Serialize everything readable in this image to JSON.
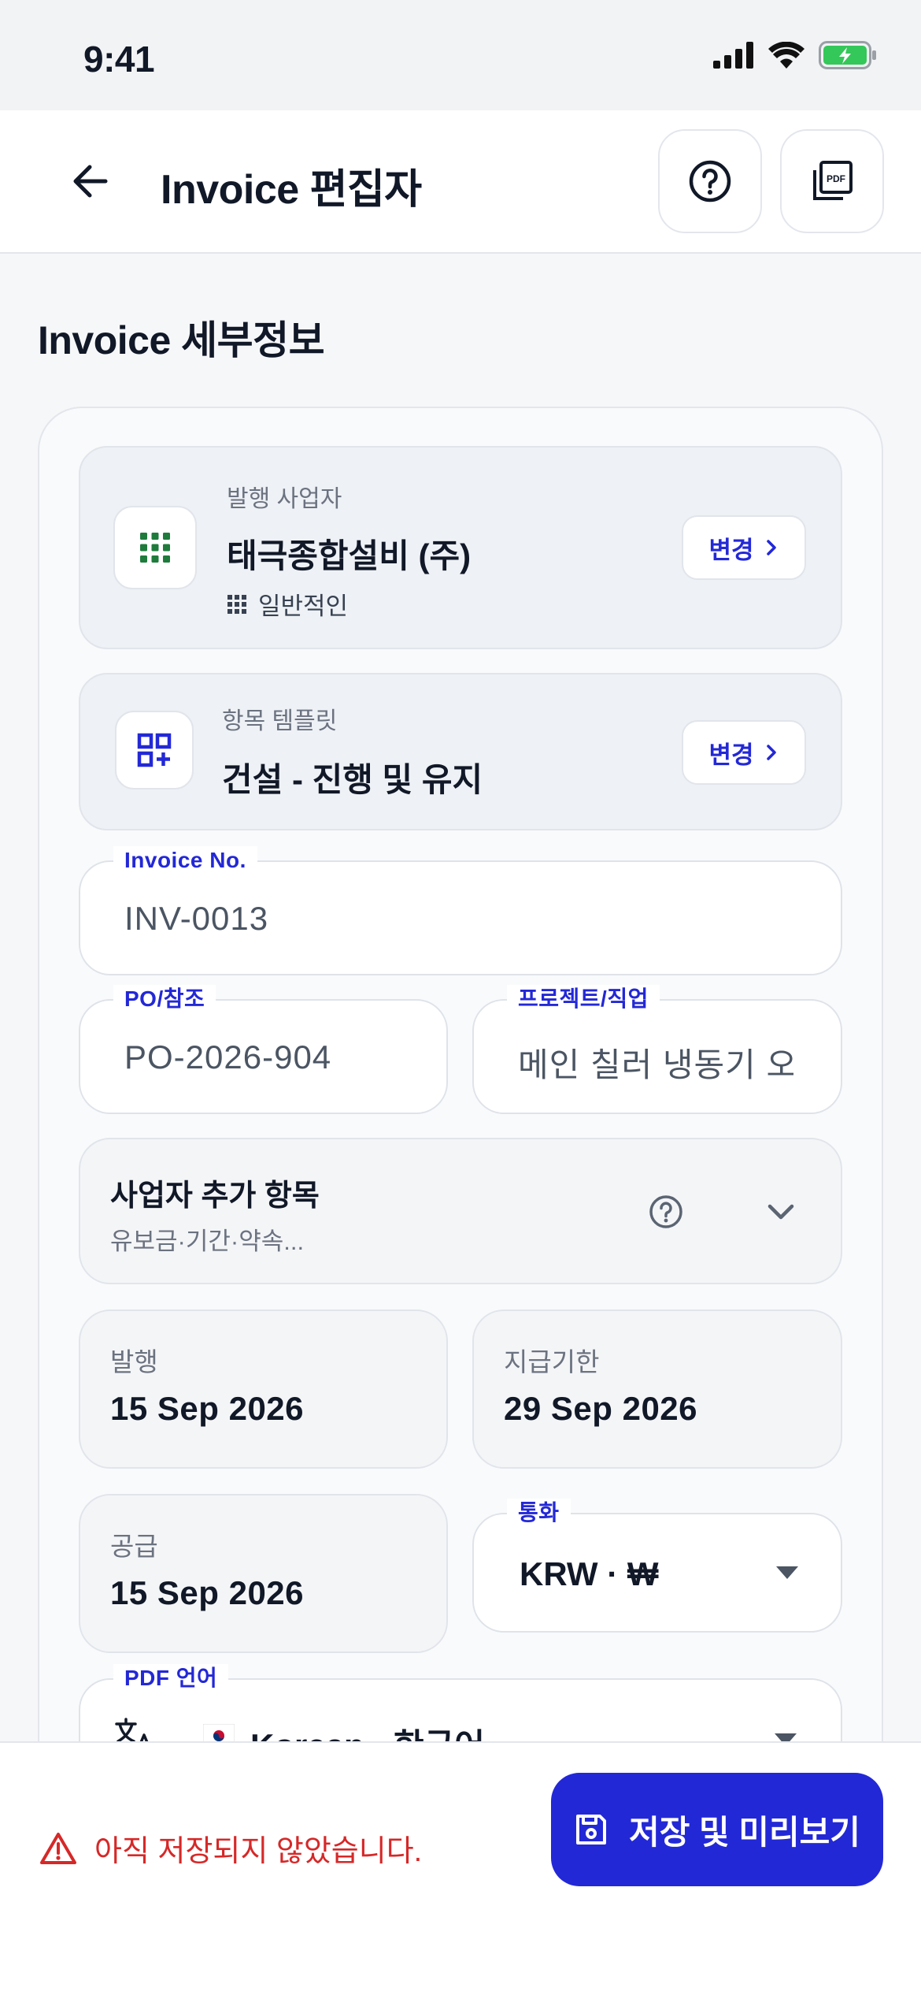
{
  "status_bar": {
    "time": "9:41"
  },
  "header": {
    "title": "Invoice 편집자",
    "pdf_label": "PDF"
  },
  "section": {
    "title": "Invoice 세부정보"
  },
  "issuer": {
    "label": "발행 사업자",
    "name": "태극종합설비 (주)",
    "type": "일반적인",
    "change_label": "변경"
  },
  "template": {
    "label": "항목 템플릿",
    "name": "건설 - 진행 및 유지",
    "change_label": "변경"
  },
  "invoice_no": {
    "label": "Invoice No.",
    "value": "INV-0013"
  },
  "po_ref": {
    "label": "PO/참조",
    "value": "PO-2026-904"
  },
  "project": {
    "label": "프로젝트/직업",
    "value": "메인 칠러 냉동기 오버홀"
  },
  "extras": {
    "title": "사업자 추가 항목",
    "subtitle": "유보금·기간·약속..."
  },
  "dates": {
    "issue": {
      "label": "발행",
      "value": "15 Sep 2026"
    },
    "due": {
      "label": "지급기한",
      "value": "29 Sep 2026"
    },
    "supply": {
      "label": "공급",
      "value": "15 Sep 2026"
    }
  },
  "currency": {
    "label": "통화",
    "value": "KRW · ₩"
  },
  "pdf_language": {
    "label": "PDF 언어",
    "value": "Korean · 한국어"
  },
  "footer": {
    "unsaved_text": "아직 저장되지 않았습니다.",
    "save_label": "저장 및 미리보기"
  },
  "colors": {
    "accent": "#2328D6",
    "error": "#D62828",
    "brand_green": "#1E7B3C"
  }
}
